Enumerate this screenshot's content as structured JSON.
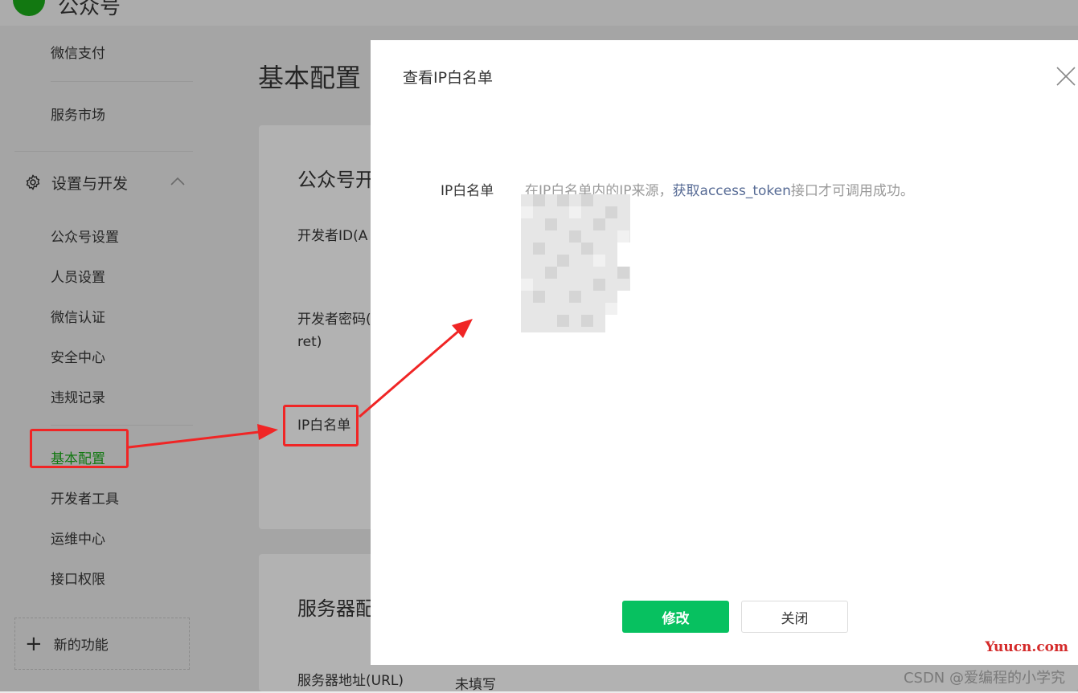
{
  "app": {
    "name": "公众号"
  },
  "sidebar": {
    "top_items": [
      "微信支付",
      "服务市场"
    ],
    "section": {
      "label": "设置与开发"
    },
    "items": [
      "公众号设置",
      "人员设置",
      "微信认证",
      "安全中心",
      "违规记录",
      "基本配置",
      "开发者工具",
      "运维中心",
      "接口权限"
    ],
    "active_item": "基本配置",
    "new_feature": "新的功能"
  },
  "main": {
    "title": "基本配置",
    "card1": {
      "title": "公众号开",
      "rows": [
        "开发者ID(A",
        "开发者密码(",
        "ret)",
        "IP白名单"
      ]
    },
    "card2": {
      "title": "服务器配",
      "row_label": "服务器地址(URL)",
      "row_value": "未填写"
    }
  },
  "dialog": {
    "title": "查看IP白名单",
    "field_label": "IP白名单",
    "desc_prefix": "在IP白名单内的IP来源，",
    "desc_link": "获取access_token",
    "desc_suffix": "接口才可调用成功。",
    "primary_button": "修改",
    "secondary_button": "关闭"
  },
  "watermarks": [
    "Yuucn.com",
    "CSDN @爱编程的小学究"
  ],
  "colors": {
    "brand_green": "#07c160",
    "active_green": "#1aad19",
    "link": "#576b95",
    "annotation_red": "#f02525"
  }
}
